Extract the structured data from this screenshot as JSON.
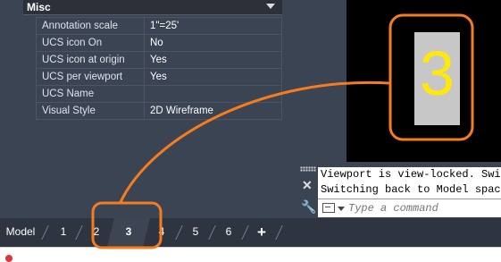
{
  "properties": {
    "section_title": "Misc",
    "rows": [
      {
        "name": "Annotation scale",
        "value": "1\"=25'"
      },
      {
        "name": "UCS icon On",
        "value": "No"
      },
      {
        "name": "UCS icon at origin",
        "value": "Yes"
      },
      {
        "name": "UCS per viewport",
        "value": "Yes"
      },
      {
        "name": "UCS Name",
        "value": ""
      },
      {
        "name": "Visual Style",
        "value": "2D Wireframe"
      }
    ]
  },
  "viewport": {
    "number": "3",
    "badge_bg": "#c7c7c7",
    "number_color": "#ffe80a"
  },
  "command_line": {
    "history": [
      "Viewport is view-locked. Swit",
      "Switching back to Model space"
    ],
    "placeholder": "Type a command"
  },
  "tabs": {
    "model": "Model",
    "layouts": [
      "1",
      "2",
      "3",
      "4",
      "5",
      "6"
    ],
    "active": "3",
    "add": "+"
  },
  "annotation": {
    "color": "#f57c1f"
  }
}
